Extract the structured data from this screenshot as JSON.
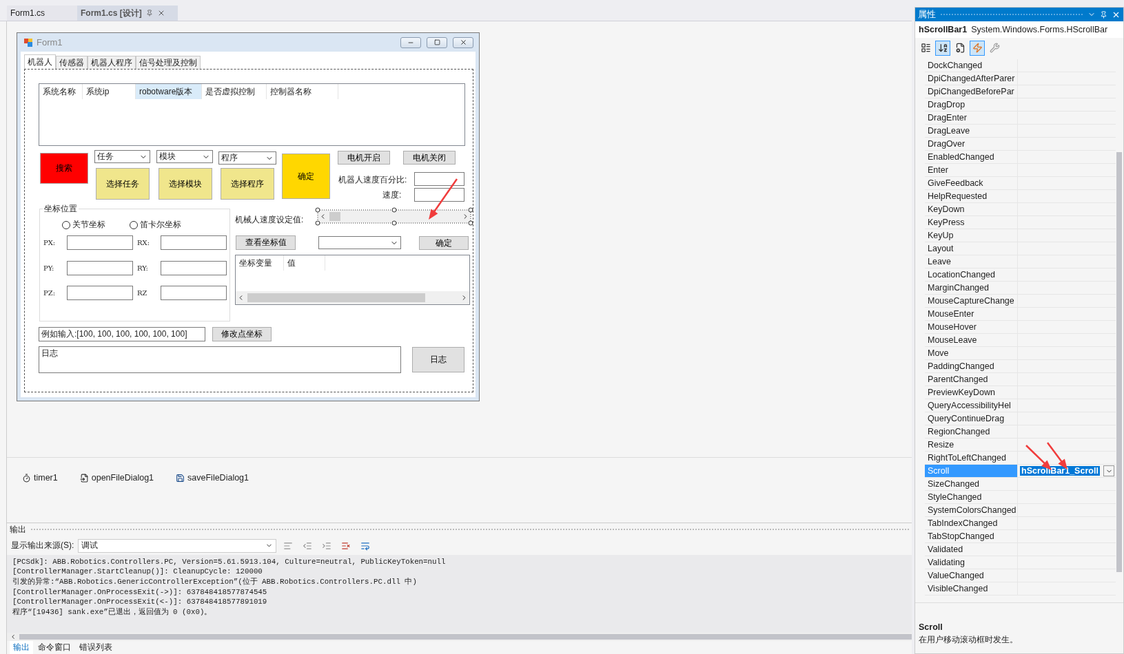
{
  "editor_tabs": [
    {
      "label": "Form1.cs",
      "selected": false
    },
    {
      "label": "Form1.cs [设计]",
      "selected": true
    }
  ],
  "form": {
    "title": "Form1",
    "tabs": [
      {
        "label": "机器人",
        "selected": true
      },
      {
        "label": "传感器",
        "selected": false
      },
      {
        "label": "机器人程序",
        "selected": false
      },
      {
        "label": "信号处理及控制",
        "selected": false
      }
    ],
    "system_list": {
      "columns": [
        {
          "label": "系统名称",
          "highlighted": false
        },
        {
          "label": "系统ip",
          "highlighted": false
        },
        {
          "label": "robotware版本",
          "highlighted": true
        },
        {
          "label": "是否虚拟控制",
          "highlighted": false
        },
        {
          "label": "控制器名称",
          "highlighted": false
        }
      ]
    },
    "search_button": "搜索",
    "dropdowns": [
      "任务",
      "模块",
      "程序"
    ],
    "select_buttons": [
      "选择任务",
      "选择模块",
      "选择程序"
    ],
    "confirm_button": "确定",
    "motor_buttons": [
      "电机开启",
      "电机关闭"
    ],
    "speed_percent_label": "机器人速度百分比:",
    "speed_label": "速度:",
    "coordinate_group": {
      "title": "坐标位置",
      "radios": [
        {
          "label": "关节坐标",
          "selected": false
        },
        {
          "label": "笛卡尔坐标",
          "selected": false
        }
      ],
      "fields": [
        {
          "label": "PX:"
        },
        {
          "label": "RX:"
        },
        {
          "label": "PY:"
        },
        {
          "label": "RY:"
        },
        {
          "label": "PZ:"
        },
        {
          "label": "RZ"
        }
      ]
    },
    "speed_setting_label": "机械人速度设定值:",
    "view_button": "查看坐标值",
    "apply_button": "确定",
    "variables_list": {
      "columns": [
        "坐标变量",
        "值"
      ]
    },
    "example_field": {
      "value": "例如输入:[100, 100, 100, 100, 100, 100]"
    },
    "modify_button": "修改点坐标",
    "log_field": {
      "value": "日志"
    },
    "log_button": "日志"
  },
  "tray": [
    {
      "label": "timer1",
      "kind": "timer"
    },
    {
      "label": "openFileDialog1",
      "kind": "open"
    },
    {
      "label": "saveFileDialog1",
      "kind": "save"
    }
  ],
  "output": {
    "title": "输出",
    "source_label": "显示输出来源(S):",
    "source_value": "调试",
    "lines": [
      "[PCSdk]: ABB.Robotics.Controllers.PC, Version=5.61.5913.104, Culture=neutral, PublicKeyToken=null",
      "[ControllerManager.StartCleanup()]: CleanupCycle: 120000",
      "引发的异常:“ABB.Robotics.GenericControllerException”(位于 ABB.Robotics.Controllers.PC.dll 中)",
      "[ControllerManager.OnProcessExit(->)]: 637848418577874545",
      "[ControllerManager.OnProcessExit(<-)]: 637848418577891019",
      "程序“[19436] sank.exe”已退出，返回值为 0 (0x0)。"
    ],
    "tabs": [
      {
        "label": "输出",
        "selected": true
      },
      {
        "label": "命令窗口",
        "selected": false
      },
      {
        "label": "错误列表",
        "selected": false
      }
    ]
  },
  "properties": {
    "title": "属性",
    "object_name": "hScrollBar1",
    "object_type": "System.Windows.Forms.HScrollBar",
    "toolbar": [
      {
        "kind": "categorized",
        "selected": false
      },
      {
        "kind": "alphabetical",
        "selected": true
      },
      {
        "kind": "properties",
        "selected": false
      },
      {
        "kind": "events",
        "selected": true
      },
      {
        "kind": "pages",
        "selected": false
      }
    ],
    "events": [
      {
        "name": "DockChanged",
        "selected": false
      },
      {
        "name": "DpiChangedAfterParer",
        "selected": false
      },
      {
        "name": "DpiChangedBeforePar",
        "selected": false
      },
      {
        "name": "DragDrop",
        "selected": false
      },
      {
        "name": "DragEnter",
        "selected": false
      },
      {
        "name": "DragLeave",
        "selected": false
      },
      {
        "name": "DragOver",
        "selected": false
      },
      {
        "name": "EnabledChanged",
        "selected": false
      },
      {
        "name": "Enter",
        "selected": false
      },
      {
        "name": "GiveFeedback",
        "selected": false
      },
      {
        "name": "HelpRequested",
        "selected": false
      },
      {
        "name": "KeyDown",
        "selected": false
      },
      {
        "name": "KeyPress",
        "selected": false
      },
      {
        "name": "KeyUp",
        "selected": false
      },
      {
        "name": "Layout",
        "selected": false
      },
      {
        "name": "Leave",
        "selected": false
      },
      {
        "name": "LocationChanged",
        "selected": false
      },
      {
        "name": "MarginChanged",
        "selected": false
      },
      {
        "name": "MouseCaptureChange",
        "selected": false
      },
      {
        "name": "MouseEnter",
        "selected": false
      },
      {
        "name": "MouseHover",
        "selected": false
      },
      {
        "name": "MouseLeave",
        "selected": false
      },
      {
        "name": "Move",
        "selected": false
      },
      {
        "name": "PaddingChanged",
        "selected": false
      },
      {
        "name": "ParentChanged",
        "selected": false
      },
      {
        "name": "PreviewKeyDown",
        "selected": false
      },
      {
        "name": "QueryAccessibilityHel",
        "selected": false
      },
      {
        "name": "QueryContinueDrag",
        "selected": false
      },
      {
        "name": "RegionChanged",
        "selected": false
      },
      {
        "name": "Resize",
        "selected": false
      },
      {
        "name": "RightToLeftChanged",
        "selected": false
      },
      {
        "name": "Scroll",
        "value": "hScrollBar1_Scroll",
        "selected": true
      },
      {
        "name": "SizeChanged",
        "selected": false
      },
      {
        "name": "StyleChanged",
        "selected": false
      },
      {
        "name": "SystemColorsChanged",
        "selected": false
      },
      {
        "name": "TabIndexChanged",
        "selected": false
      },
      {
        "name": "TabStopChanged",
        "selected": false
      },
      {
        "name": "Validated",
        "selected": false
      },
      {
        "name": "Validating",
        "selected": false
      },
      {
        "name": "ValueChanged",
        "selected": false
      },
      {
        "name": "VisibleChanged",
        "selected": false
      }
    ],
    "description": {
      "title": "Scroll",
      "text": "在用户移动滚动框时发生。"
    }
  }
}
